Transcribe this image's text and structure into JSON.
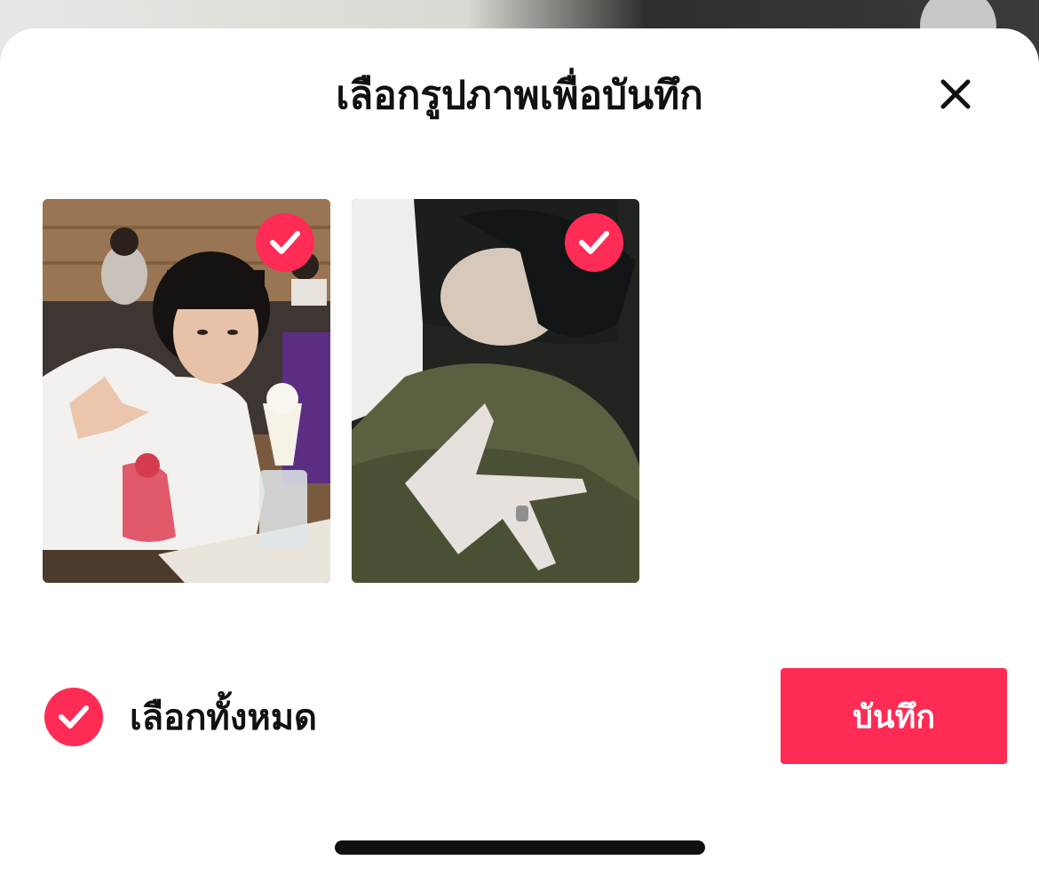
{
  "backdrop": {
    "more_icon": "more-horizontal-icon"
  },
  "sheet": {
    "title": "เลือกรูปภาพเพื่อบันทึก",
    "close_icon": "close-icon"
  },
  "photos": [
    {
      "description_icon": "photo-thumbnail",
      "selected": true,
      "check_icon": "checkmark-icon"
    },
    {
      "description_icon": "photo-thumbnail",
      "selected": true,
      "check_icon": "checkmark-icon"
    }
  ],
  "footer": {
    "select_all_label": "เลือกทั้งหมด",
    "select_all_checked": true,
    "save_label": "บันทึก"
  },
  "colors": {
    "accent": "#fe2c55",
    "text": "#111111",
    "sheet_background": "#ffffff"
  }
}
